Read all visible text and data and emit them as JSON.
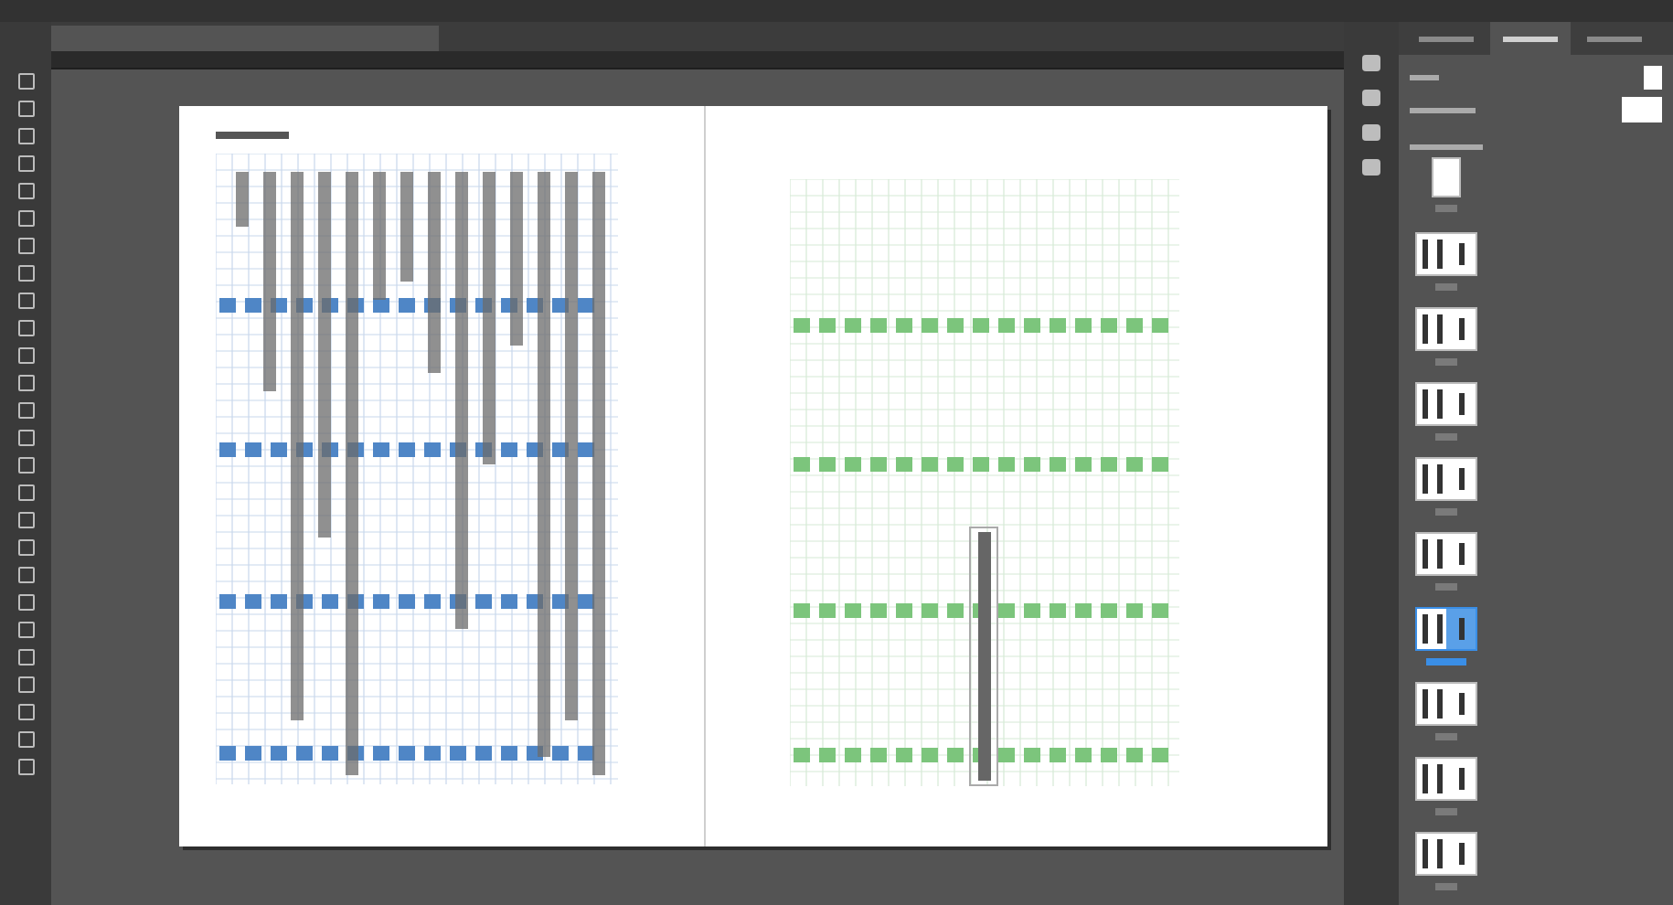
{
  "panel_tabs": [
    {
      "selected": false
    },
    {
      "selected": true
    },
    {
      "selected": false
    }
  ],
  "page_thumbnails": [
    {
      "kind": "single",
      "selected": false
    },
    {
      "kind": "spread",
      "selected": false
    },
    {
      "kind": "spread",
      "selected": false
    },
    {
      "kind": "spread",
      "selected": false
    },
    {
      "kind": "spread",
      "selected": false
    },
    {
      "kind": "spread",
      "selected": false
    },
    {
      "kind": "spread",
      "selected": true
    },
    {
      "kind": "spread",
      "selected": false
    },
    {
      "kind": "spread",
      "selected": false
    },
    {
      "kind": "spread",
      "selected": false
    }
  ]
}
